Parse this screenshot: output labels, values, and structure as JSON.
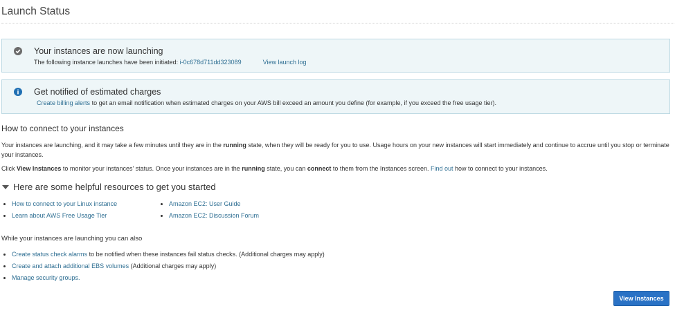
{
  "page": {
    "title": "Launch Status"
  },
  "success_alert": {
    "heading": "Your instances are now launching",
    "text": "The following instance launches have been initiated:",
    "instance_id": "i-0c678d711dd323089",
    "log_link": "View launch log"
  },
  "info_alert": {
    "heading": "Get notified of estimated charges",
    "link": "Create billing alerts",
    "text": "to get an email notification when estimated charges on your AWS bill exceed an amount you define (for example, if you exceed the free usage tier)."
  },
  "connect": {
    "title": "How to connect to your instances",
    "p1_a": "Your instances are launching, and it may take a few minutes until they are in the",
    "p1_bold": "running",
    "p1_b": "state, when they will be ready for you to use. Usage hours on your new instances will start immediately and continue to accrue until you stop or terminate your instances.",
    "p2_a": "Click",
    "p2_bold1": "View Instances",
    "p2_b": "to monitor your instances' status. Once your instances are in the",
    "p2_bold2": "running",
    "p2_c": "state, you can",
    "p2_bold3": "connect",
    "p2_d": "to them from the Instances screen.",
    "p2_link": "Find out",
    "p2_e": "how to connect to your instances."
  },
  "resources": {
    "title": "Here are some helpful resources to get you started",
    "col1": [
      "How to connect to your Linux instance",
      "Learn about AWS Free Usage Tier"
    ],
    "col2": [
      "Amazon EC2: User Guide",
      "Amazon EC2: Discussion Forum"
    ]
  },
  "also": {
    "title": "While your instances are launching you can also",
    "item1_link": "Create status check alarms",
    "item1_text": "to be notified when these instances fail status checks. (Additional charges may apply)",
    "item2_link": "Create and attach additional EBS volumes",
    "item2_text": "(Additional charges may apply)",
    "item3_link": "Manage security groups."
  },
  "footer": {
    "view_instances_label": "View Instances"
  },
  "colors": {
    "link": "#2f6f93",
    "alert_bg": "#eef6f8",
    "alert_border": "#bcd9e3",
    "primary": "#2a72c5"
  }
}
